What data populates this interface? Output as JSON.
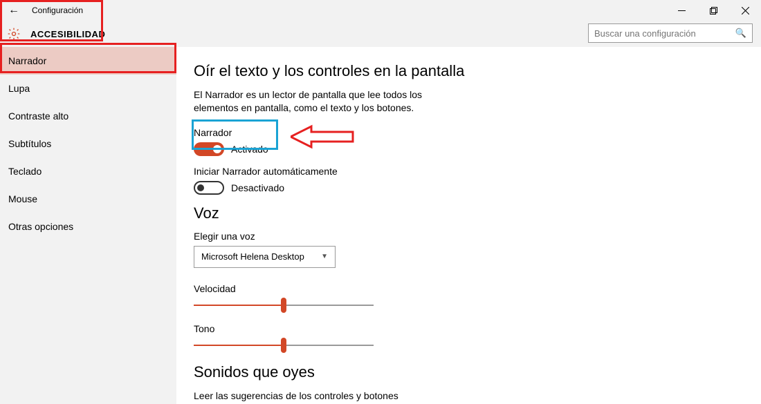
{
  "titlebar": {
    "title": "Configuración"
  },
  "header": {
    "title": "ACCESIBILIDAD"
  },
  "search": {
    "placeholder": "Buscar una configuración"
  },
  "sidebar": {
    "items": [
      {
        "label": "Narrador",
        "selected": true
      },
      {
        "label": "Lupa"
      },
      {
        "label": "Contraste alto"
      },
      {
        "label": "Subtítulos"
      },
      {
        "label": "Teclado"
      },
      {
        "label": "Mouse"
      },
      {
        "label": "Otras opciones"
      }
    ]
  },
  "main": {
    "section1_title": "Oír el texto y los controles en la pantalla",
    "section1_desc": "El Narrador es un lector de pantalla que lee todos los elementos en pantalla, como el texto y los botones.",
    "toggle1_label": "Narrador",
    "toggle1_state": "Activado",
    "toggle2_label": "Iniciar Narrador automáticamente",
    "toggle2_state": "Desactivado",
    "section_voice": "Voz",
    "voice_label": "Elegir una voz",
    "voice_value": "Microsoft Helena Desktop",
    "speed_label": "Velocidad",
    "tone_label": "Tono",
    "section_sounds": "Sonidos que oyes",
    "sounds_desc": "Leer las sugerencias de los controles y botones"
  },
  "colors": {
    "accent": "#d24726",
    "highlight_red": "#e62020",
    "highlight_cyan": "#1aa3d4"
  }
}
